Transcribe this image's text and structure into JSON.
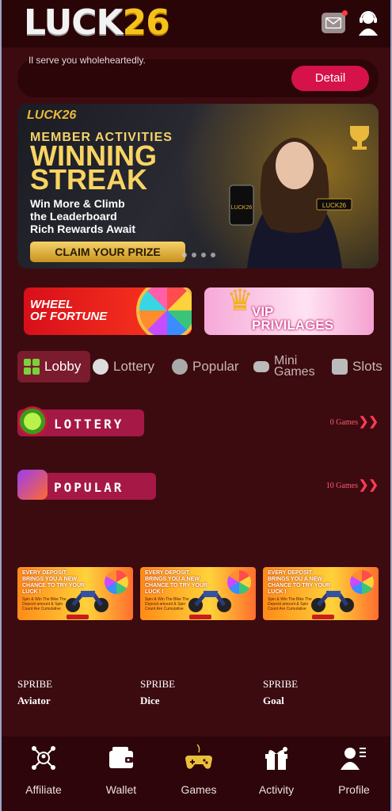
{
  "header": {
    "logo_part1": "LUCK",
    "logo_part2": "26"
  },
  "marquee": {
    "text": "Il serve you wholeheartedly.",
    "button": "Detail"
  },
  "banner": {
    "brand": "LUCK26",
    "subtitle": "MEMBER ACTIVITIES",
    "headline1": "WINNING",
    "headline2": "STREAK",
    "lines": [
      "Win More & Climb",
      "the Leaderboard",
      "Rich Rewards Await"
    ],
    "cta": "CLAIM YOUR PRIZE",
    "card_label": "LUCK26"
  },
  "promos": {
    "wheel_line1": "WHEEL",
    "wheel_line2": "OF FORTUNE",
    "vip_line1": "VIP",
    "vip_line2": "PRIVILAGES"
  },
  "tabs": [
    {
      "label": "Lobby"
    },
    {
      "label": "Lottery"
    },
    {
      "label": "Popular"
    },
    {
      "label_line1": "Mini",
      "label_line2": "Games"
    },
    {
      "label": "Slots"
    }
  ],
  "sections": {
    "lottery": {
      "title": "LOTTERY",
      "count": "0 Games"
    },
    "popular": {
      "title": "POPULAR",
      "count": "10 Games"
    }
  },
  "games": [
    {
      "provider": "SPRIBE",
      "name": "Aviator"
    },
    {
      "provider": "SPRIBE",
      "name": "Dice"
    },
    {
      "provider": "SPRIBE",
      "name": "Goal"
    }
  ],
  "game_card": {
    "headline": "EVERY DEPOSIT BRINGS YOU A NEW CHANCE TO TRY YOUR LUCK !",
    "fine": "Spin & Win The Bike The Deposit amount & Spin Count Are Cumulative"
  },
  "nav": [
    {
      "label": "Affiliate",
      "icon": "affiliate-icon"
    },
    {
      "label": "Wallet",
      "icon": "wallet-icon"
    },
    {
      "label": "Games",
      "icon": "gamepad-icon"
    },
    {
      "label": "Activity",
      "icon": "gift-icon"
    },
    {
      "label": "Profile",
      "icon": "profile-icon"
    }
  ],
  "colors": {
    "background": "#3c0b10",
    "accent": "#d6124a",
    "gold": "#f5c21a"
  }
}
